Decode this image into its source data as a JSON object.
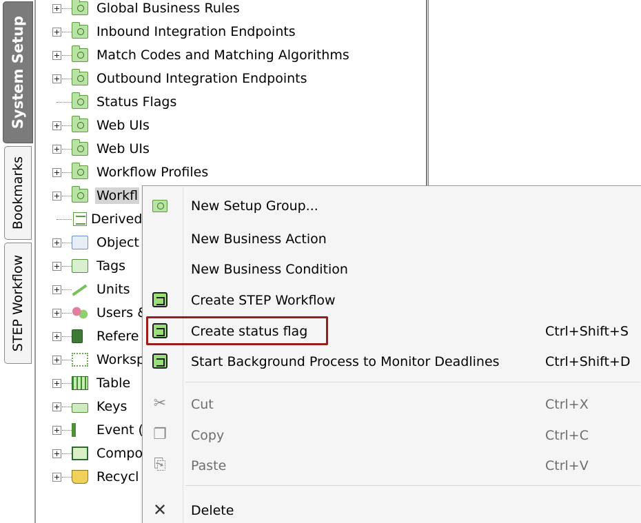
{
  "tabs": [
    {
      "label": "System Setup",
      "active": true
    },
    {
      "label": "Bookmarks",
      "active": false
    },
    {
      "label": "STEP Workflow",
      "active": false
    }
  ],
  "tree": {
    "items": [
      {
        "label": "Global Business Rules",
        "icon": "setup-folder-icon",
        "expandable": true
      },
      {
        "label": "Inbound Integration Endpoints",
        "icon": "setup-folder-icon",
        "expandable": true
      },
      {
        "label": "Match Codes and Matching Algorithms",
        "icon": "setup-folder-icon",
        "expandable": true
      },
      {
        "label": "Outbound Integration Endpoints",
        "icon": "setup-folder-icon",
        "expandable": true
      },
      {
        "label": "Status Flags",
        "icon": "setup-folder-icon",
        "expandable": false
      },
      {
        "label": "Web UIs",
        "icon": "setup-folder-icon",
        "expandable": true
      },
      {
        "label": "Web UIs",
        "icon": "setup-folder-icon",
        "expandable": true
      },
      {
        "label": "Workflow Profiles",
        "icon": "setup-folder-icon",
        "expandable": true
      },
      {
        "label": "Workfl",
        "icon": "setup-folder-icon",
        "expandable": true,
        "selected": true
      },
      {
        "label": "Derived",
        "icon": "derived-document-icon",
        "expandable": false
      },
      {
        "label": "Object",
        "icon": "object-type-icon",
        "expandable": true
      },
      {
        "label": "Tags",
        "icon": "tags-icon",
        "expandable": true
      },
      {
        "label": "Units",
        "icon": "units-ruler-icon",
        "expandable": true
      },
      {
        "label": "Users &",
        "icon": "users-icon",
        "expandable": true
      },
      {
        "label": "Refere",
        "icon": "reference-icon",
        "expandable": true
      },
      {
        "label": "Worksp",
        "icon": "workspace-icon",
        "expandable": true
      },
      {
        "label": "Table",
        "icon": "table-icon",
        "expandable": true
      },
      {
        "label": "Keys",
        "icon": "keys-icon",
        "expandable": true
      },
      {
        "label": "Event (",
        "icon": "event-icon",
        "expandable": true
      },
      {
        "label": "Compo",
        "icon": "component-icon",
        "expandable": true
      },
      {
        "label": "Recycl",
        "icon": "recycle-bin-icon",
        "expandable": true
      }
    ]
  },
  "context_menu": {
    "items": [
      {
        "label": "New Setup Group...",
        "shortcut": "",
        "icon": "setup-group-icon",
        "enabled": true
      },
      {
        "label": "New Business Action",
        "shortcut": "",
        "icon": "",
        "enabled": true
      },
      {
        "label": "New Business Condition",
        "shortcut": "",
        "icon": "",
        "enabled": true
      },
      {
        "label": "Create STEP Workflow",
        "shortcut": "",
        "icon": "workflow-icon",
        "enabled": true
      },
      {
        "label": "Create status flag",
        "shortcut": "Ctrl+Shift+S",
        "icon": "workflow-icon",
        "enabled": true,
        "highlighted": true
      },
      {
        "label": "Start Background Process to Monitor Deadlines",
        "shortcut": "Ctrl+Shift+D",
        "icon": "workflow-icon",
        "enabled": true
      },
      {
        "label": "Cut",
        "shortcut": "Ctrl+X",
        "icon": "scissors-icon",
        "enabled": false
      },
      {
        "label": "Copy",
        "shortcut": "Ctrl+C",
        "icon": "copy-icon",
        "enabled": false
      },
      {
        "label": "Paste",
        "shortcut": "Ctrl+V",
        "icon": "paste-icon",
        "enabled": false
      },
      {
        "label": "Delete",
        "shortcut": "",
        "icon": "delete-x-icon",
        "enabled": true
      }
    ]
  },
  "colors": {
    "highlight_border": "#9b1b1b",
    "active_tab": "#7b7b7b",
    "selection": "#d4d4d4",
    "folder_green": "#b9e3a4"
  }
}
